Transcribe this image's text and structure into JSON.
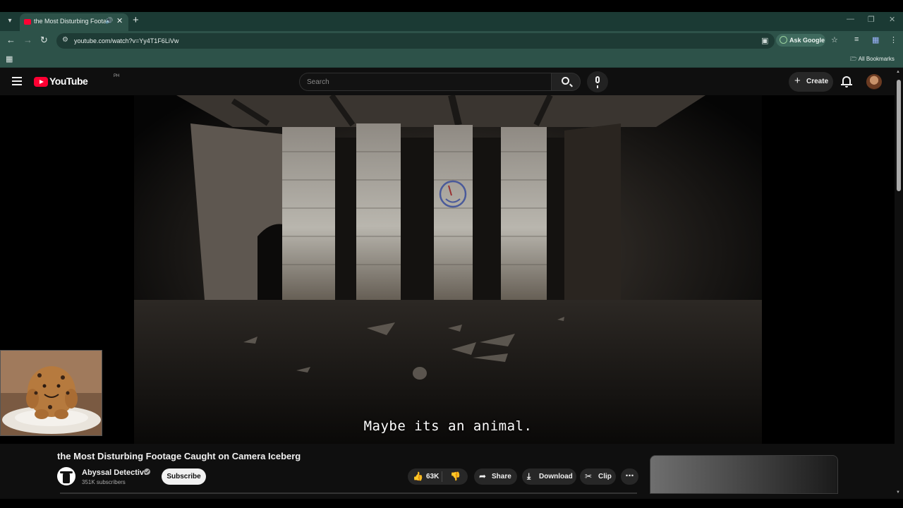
{
  "browser": {
    "tab_title": "the Most Disturbing Footage Caught on Camera Iceberg",
    "url": "youtube.com/watch?v=Yy4T1F6LiVw",
    "ask_google_label": "Ask Google",
    "all_bookmarks_label": "All Bookmarks",
    "accent": "#2d5249"
  },
  "youtube": {
    "logo_text": "YouTube",
    "country_code": "PH",
    "search_placeholder": "Search",
    "create_label": "Create",
    "brand_color": "#ff0033"
  },
  "video": {
    "caption": "Maybe its an animal.",
    "title": "the Most Disturbing Footage Caught on Camera Iceberg"
  },
  "channel": {
    "name": "Abyssal Detective",
    "subscribers": "351K subscribers",
    "subscribe_label": "Subscribe"
  },
  "actions": {
    "likes": "63K",
    "share_label": "Share",
    "download_label": "Download",
    "clip_label": "Clip"
  },
  "icons": [
    "tab-list-icon",
    "audio-icon",
    "close-icon",
    "plus-icon",
    "back-icon",
    "forward-icon",
    "reload-icon",
    "site-info-icon",
    "install-icon",
    "star-icon",
    "reading-list-icon",
    "extension-icon",
    "menu-icon",
    "apps-icon",
    "folder-icon",
    "hamburger-icon",
    "search-icon",
    "mic-icon",
    "bell-icon",
    "thumbs-up-icon",
    "thumbs-down-icon",
    "share-icon",
    "download-icon",
    "scissors-icon",
    "more-icon",
    "verified-icon"
  ]
}
